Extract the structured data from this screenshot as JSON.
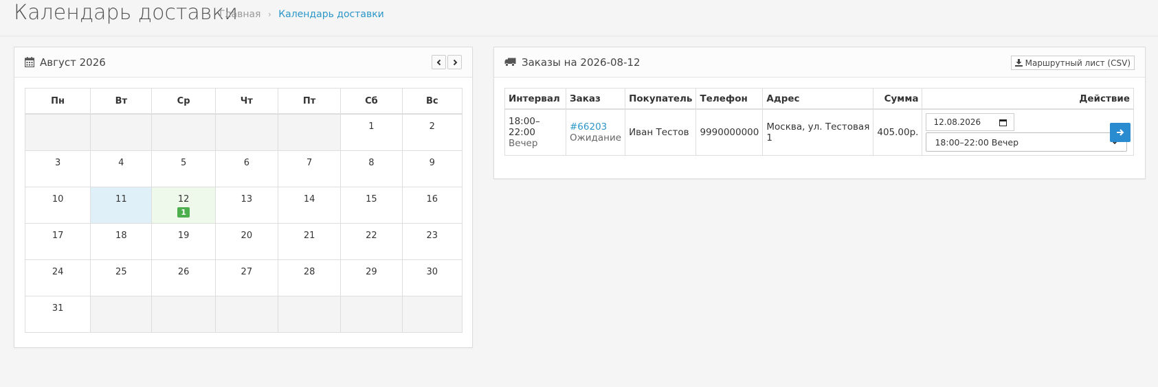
{
  "header": {
    "title": "Календарь доставки",
    "breadcrumb": {
      "home": "Главная",
      "separator": "›",
      "current": "Календарь доставки"
    }
  },
  "calendar": {
    "title": "Август 2026",
    "icons": {
      "header": "calendar-icon",
      "prev": "chevron-left-icon",
      "next": "chevron-right-icon"
    },
    "weekdays": [
      "Пн",
      "Вт",
      "Ср",
      "Чт",
      "Пт",
      "Сб",
      "Вс"
    ],
    "weeks": [
      [
        "",
        "",
        "",
        "",
        "",
        "1",
        "2"
      ],
      [
        "3",
        "4",
        "5",
        "6",
        "7",
        "8",
        "9"
      ],
      [
        "10",
        "11",
        "12",
        "13",
        "14",
        "15",
        "16"
      ],
      [
        "17",
        "18",
        "19",
        "20",
        "21",
        "22",
        "23"
      ],
      [
        "24",
        "25",
        "26",
        "27",
        "28",
        "29",
        "30"
      ],
      [
        "31",
        "",
        "",
        "",
        "",
        "",
        ""
      ]
    ],
    "today": "11",
    "selected": "12",
    "badges": {
      "12": "1"
    },
    "colors": {
      "today": "#dff0f8",
      "selected": "#eef8eb",
      "badge": "#4cae4c"
    }
  },
  "orders": {
    "title": "Заказы на 2026-08-12",
    "header_icon": "truck-icon",
    "csv_button": "Маршрутный лист (CSV)",
    "csv_icon": "download-icon",
    "columns": [
      "Интервал",
      "Заказ",
      "Покупатель",
      "Телефон",
      "Адрес",
      "Сумма",
      "Действие"
    ],
    "rows": [
      {
        "interval_time": "18:00–22:00",
        "interval_name": "Вечер",
        "order_number": "#66203",
        "order_status": "Ожидание",
        "customer": "Иван Тестов",
        "phone": "9990000000",
        "address": "Москва, ул. Тестовая 1",
        "sum": "405.00р.",
        "date_value": "12.08.2026",
        "slot_value": "18:00–22:00 Вечер"
      }
    ],
    "action_icon": "arrow-right-icon",
    "colors": {
      "link": "#2a96c9",
      "action_button": "#2a8cd0"
    }
  }
}
